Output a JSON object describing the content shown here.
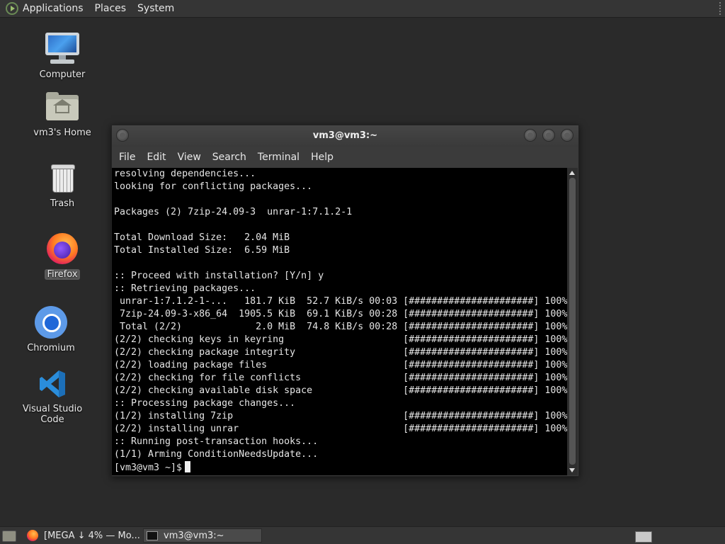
{
  "top_panel": {
    "menus": [
      "Applications",
      "Places",
      "System"
    ]
  },
  "desktop": {
    "icons": [
      {
        "label": "Computer"
      },
      {
        "label": "vm3's Home"
      },
      {
        "label": "Trash"
      },
      {
        "label": "Firefox"
      },
      {
        "label": "Chromium"
      },
      {
        "label": "Visual Studio Code"
      }
    ]
  },
  "terminal": {
    "title": "vm3@vm3:~",
    "menus": [
      "File",
      "Edit",
      "View",
      "Search",
      "Terminal",
      "Help"
    ],
    "lines": [
      "resolving dependencies...",
      "looking for conflicting packages...",
      "",
      "Packages (2) 7zip-24.09-3  unrar-1:7.1.2-1",
      "",
      "Total Download Size:   2.04 MiB",
      "Total Installed Size:  6.59 MiB",
      "",
      ":: Proceed with installation? [Y/n] y",
      ":: Retrieving packages...",
      " unrar-1:7.1.2-1-...   181.7 KiB  52.7 KiB/s 00:03 [######################] 100%",
      " 7zip-24.09-3-x86_64  1905.5 KiB  69.1 KiB/s 00:28 [######################] 100%",
      " Total (2/2)             2.0 MiB  74.8 KiB/s 00:28 [######################] 100%",
      "(2/2) checking keys in keyring                     [######################] 100%",
      "(2/2) checking package integrity                   [######################] 100%",
      "(2/2) loading package files                        [######################] 100%",
      "(2/2) checking for file conflicts                  [######################] 100%",
      "(2/2) checking available disk space                [######################] 100%",
      ":: Processing package changes...",
      "(1/2) installing 7zip                              [######################] 100%",
      "(2/2) installing unrar                             [######################] 100%",
      ":: Running post-transaction hooks...",
      "(1/1) Arming ConditionNeedsUpdate..."
    ],
    "prompt": "[vm3@vm3 ~]$"
  },
  "taskbar": {
    "tasks": [
      {
        "label": "[MEGA ↓ 4% — Mo..."
      },
      {
        "label": "vm3@vm3:~"
      }
    ]
  }
}
